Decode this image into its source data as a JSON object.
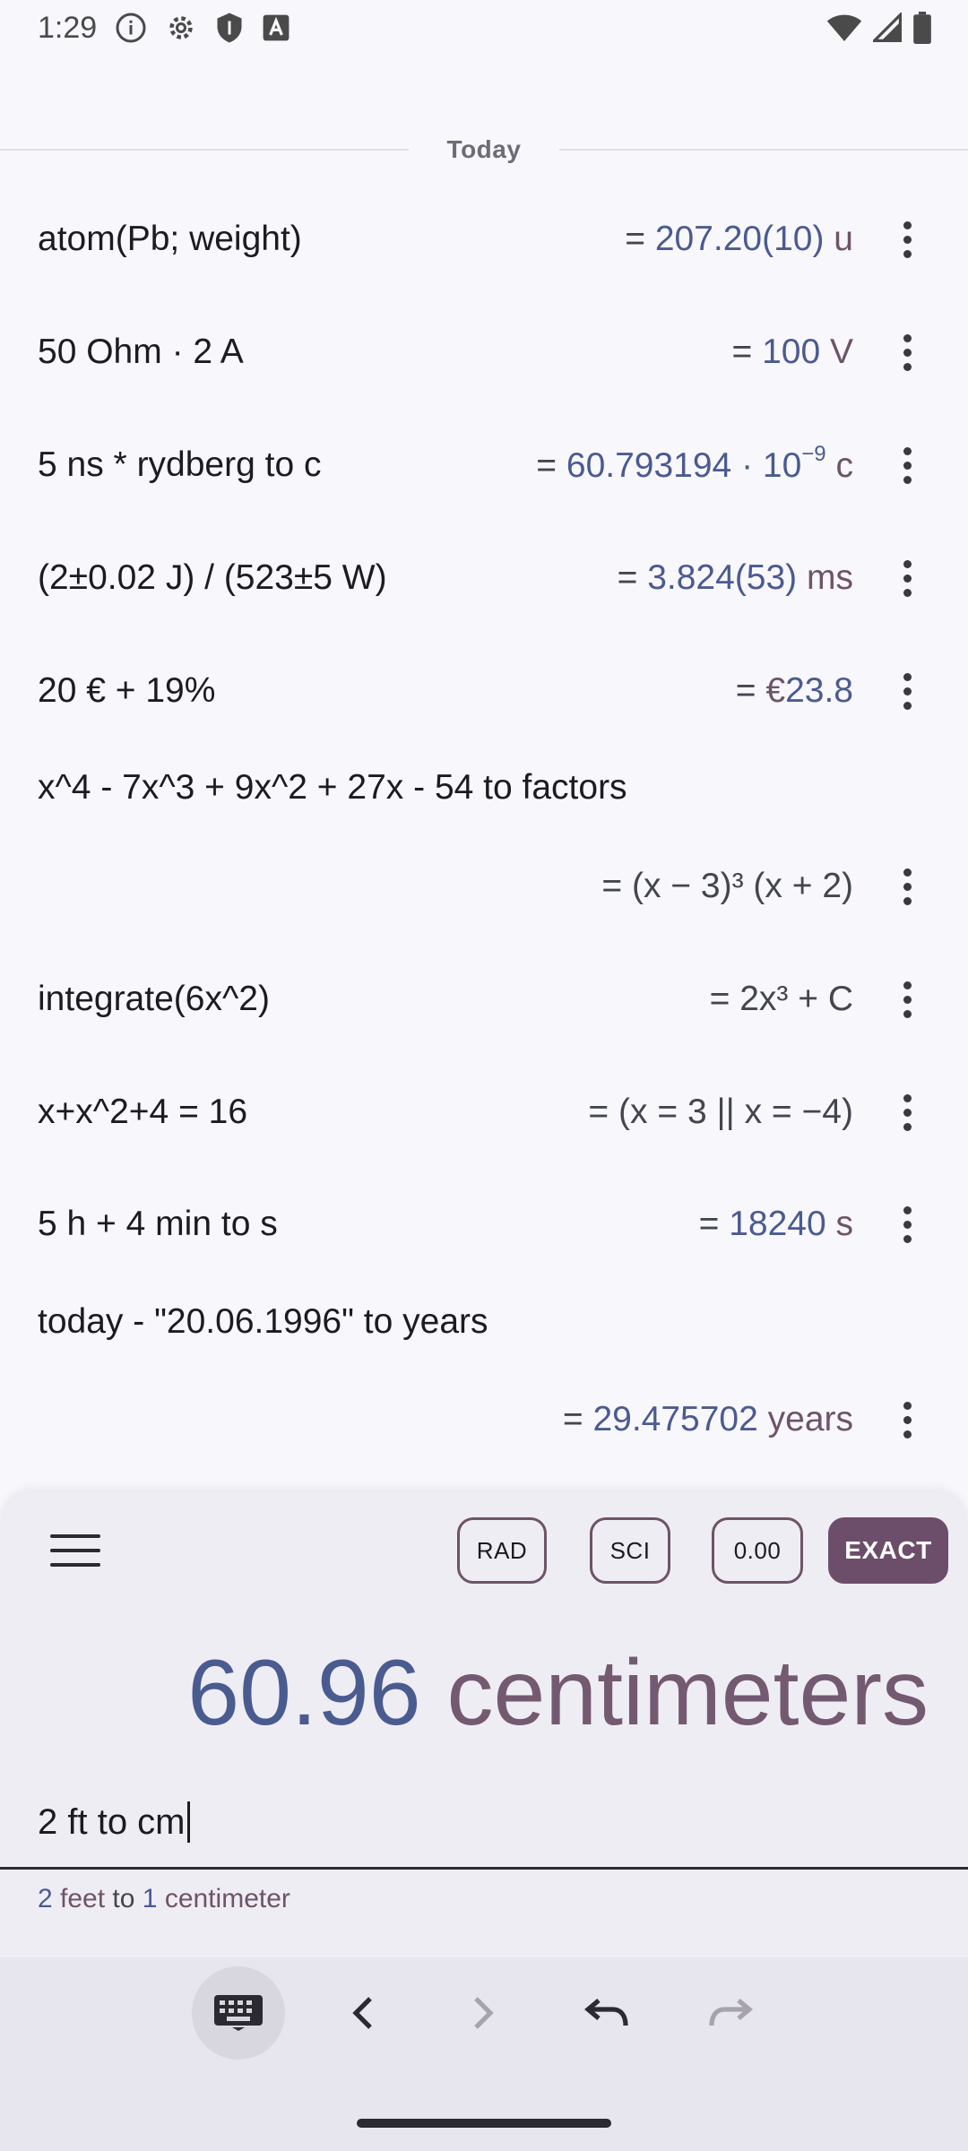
{
  "status": {
    "time": "1:29"
  },
  "history": {
    "day_label": "Today",
    "entries": [
      {
        "expr": "atom(Pb; weight)",
        "result": {
          "eq": "= ",
          "value": "207.20(10)",
          "unit": " u"
        }
      },
      {
        "expr": "50 Ohm · 2 A",
        "result": {
          "eq": "= ",
          "value": "100",
          "unit": " V"
        }
      },
      {
        "expr": "5 ns * rydberg to c",
        "result": {
          "eq": "= ",
          "value": "60.793194 · 10",
          "exp": "−9",
          "unit": " c"
        }
      },
      {
        "expr": "(2±0.02 J) / (523±5 W)",
        "result": {
          "eq": "= ",
          "value": "3.824(53)",
          "unit": " ms"
        }
      },
      {
        "expr": "20 € + 19%",
        "result": {
          "eq": "= ",
          "unit_prefix": "€",
          "value": "23.8"
        }
      },
      {
        "expr": "x^4 - 7x^3 + 9x^2 + 27x - 54 to factors",
        "result": {
          "text": "= (x − 3)³ (x + 2)"
        }
      },
      {
        "expr": "integrate(6x^2)",
        "result": {
          "text": "= 2x³ + C"
        }
      },
      {
        "expr": "x+x^2+4 = 16",
        "result": {
          "text": "= (x = 3 || x = −4)"
        }
      },
      {
        "expr": "5 h + 4 min to s",
        "result": {
          "eq": "= ",
          "value": "18240",
          "unit": " s"
        }
      },
      {
        "expr": "today - \"20.06.1996\" to years",
        "result": {
          "eq": "= ",
          "value": "29.475702",
          "unit": " years"
        }
      }
    ]
  },
  "modes": {
    "angle": "RAD",
    "notation": "SCI",
    "precision": "0.00",
    "exact": "EXACT"
  },
  "current": {
    "result_value": "60.96",
    "result_unit": "centimeters",
    "input": "2 ft to cm",
    "hint": {
      "a_num": "2",
      "a_unit": "feet",
      "to": "to",
      "b_num": "1",
      "b_unit": "centimeter"
    }
  }
}
